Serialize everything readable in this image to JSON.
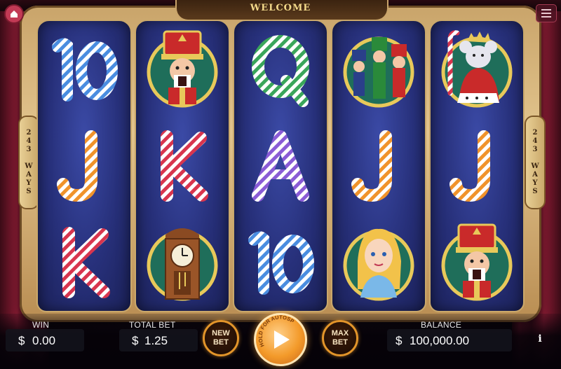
{
  "header": {
    "welcome": "WELCOME"
  },
  "frame": {
    "ways_left": "243 WAYS",
    "ways_right": "243 WAYS"
  },
  "reels": [
    [
      "10",
      "nutcracker-soldier",
      "K"
    ],
    [
      "nutcracker-soldier",
      "K",
      "grandfather-clock"
    ],
    [
      "Q",
      "A",
      "10"
    ],
    [
      "nutcracker-trio",
      "J",
      "princess-clara"
    ],
    [
      "mouse-king",
      "J",
      "nutcracker-soldier"
    ]
  ],
  "reel_labels": {
    "r0c0": "10",
    "r0c1": "J",
    "r0c2": "K",
    "r1c1": "K",
    "r2c0": "Q",
    "r2c1": "A",
    "r2c2": "10",
    "r3c1": "J",
    "r4c1": "J"
  },
  "bottom": {
    "win_label": "WIN",
    "win_currency": "$",
    "win_value": "0.00",
    "total_bet_label": "TOTAL BET",
    "total_bet_currency": "$",
    "total_bet_value": "1.25",
    "new_bet_label_1": "NEW",
    "new_bet_label_2": "BET",
    "spin_hint": "HOLD FOR AUTOSPIN",
    "max_bet_label_1": "MAX",
    "max_bet_label_2": "BET",
    "balance_label": "BALANCE",
    "balance_currency": "$",
    "balance_value": "100,000.00",
    "info": "i"
  },
  "colors": {
    "accent": "#e3952a",
    "frame_gold": "#caa86a",
    "reel_blue": "#27307a",
    "candy_red": "#d8354e",
    "candy_blue": "#4a8de0",
    "candy_orange": "#f0932b",
    "candy_green": "#3aa65a",
    "candy_purple": "#8a5cd6"
  }
}
